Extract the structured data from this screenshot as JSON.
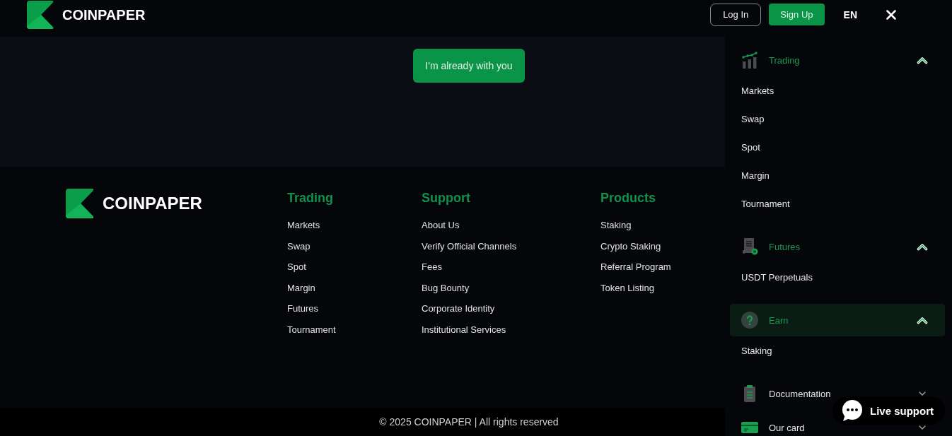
{
  "header": {
    "brand": "COINPAPER",
    "buttons": [
      {
        "label": "Log In",
        "kind": "outline"
      },
      {
        "label": "Sign Up",
        "kind": "primary"
      }
    ],
    "language": "EN"
  },
  "hero": {
    "button": "I'm already with you"
  },
  "footer": {
    "brand": "COINPAPER",
    "columns": [
      {
        "title": "Trading",
        "links": [
          "Markets",
          "Swap",
          "Spot",
          "Margin",
          "Futures",
          "Tournament"
        ]
      },
      {
        "title": "Support",
        "links": [
          "About Us",
          "Verify Official Channels",
          "Fees",
          "Bug Bounty",
          "Corporate Identity",
          "Institutional Services"
        ]
      },
      {
        "title": "Products",
        "links": [
          "Staking",
          "Crypto Staking",
          "Referral Program",
          "Token Listing"
        ]
      }
    ],
    "copyright": "© 2025 COINPAPER | All rights reserved"
  },
  "menu": {
    "sections": [
      {
        "label": "Trading",
        "kind": "chart",
        "expanded": true,
        "selected": false,
        "items": [
          "Markets",
          "Swap",
          "Spot",
          "Margin",
          "Tournament"
        ]
      },
      {
        "label": "Futures",
        "kind": "document",
        "expanded": true,
        "selected": false,
        "items": [
          "USDT Perpetuals"
        ]
      },
      {
        "label": "Earn",
        "kind": "help",
        "expanded": true,
        "selected": true,
        "items": [
          "Staking"
        ]
      },
      {
        "label": "Documentation",
        "kind": "clipboard",
        "expanded": false,
        "selected": false
      },
      {
        "label": "Our card",
        "kind": "card",
        "expanded": false,
        "selected": false
      }
    ]
  },
  "live_support": {
    "label": "Live support"
  }
}
